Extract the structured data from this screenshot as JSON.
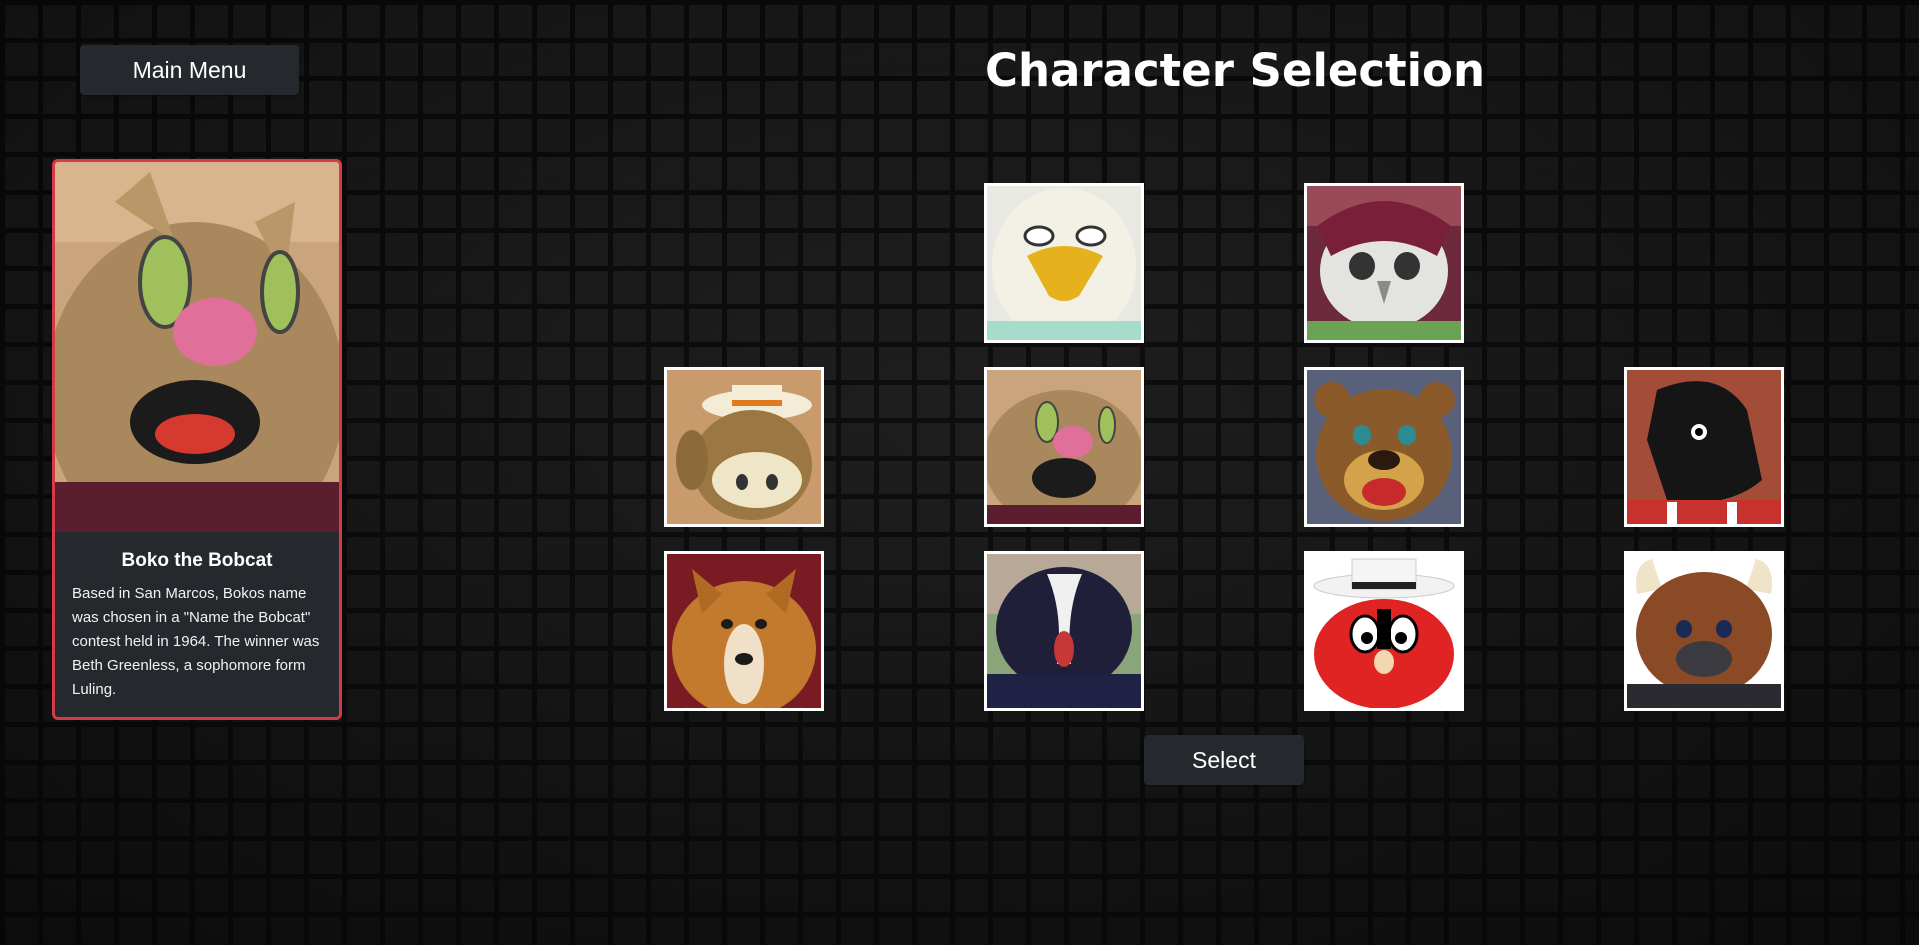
{
  "menu": {
    "main_menu_label": "Main Menu"
  },
  "title": "Character Selection",
  "selected": {
    "name": "Boko the Bobcat",
    "description": "Based in San Marcos, Bokos name was chosen in a \"Name the Bobcat\" contest held in 1964. The winner was Beth Greenless, a sophomore form Luling."
  },
  "characters": [
    {
      "slot": "row1-col2",
      "icon": "eagle-mascot"
    },
    {
      "slot": "row1-col3",
      "icon": "owl-mascot"
    },
    {
      "slot": "row2-col1",
      "icon": "longhorn-mascot"
    },
    {
      "slot": "row2-col2",
      "icon": "bobcat-mascot",
      "selected": true
    },
    {
      "slot": "row2-col3",
      "icon": "bear-mascot"
    },
    {
      "slot": "row2-col4",
      "icon": "mustang-mascot"
    },
    {
      "slot": "row3-col1",
      "icon": "collie-mascot"
    },
    {
      "slot": "row3-col2",
      "icon": "skunk-mascot"
    },
    {
      "slot": "row3-col3",
      "icon": "cowboy-mascot"
    },
    {
      "slot": "row3-col4",
      "icon": "bison-mascot"
    }
  ],
  "actions": {
    "select_label": "Select"
  },
  "colors": {
    "selected_border": "#d53a48",
    "button_bg": "#25282d"
  }
}
